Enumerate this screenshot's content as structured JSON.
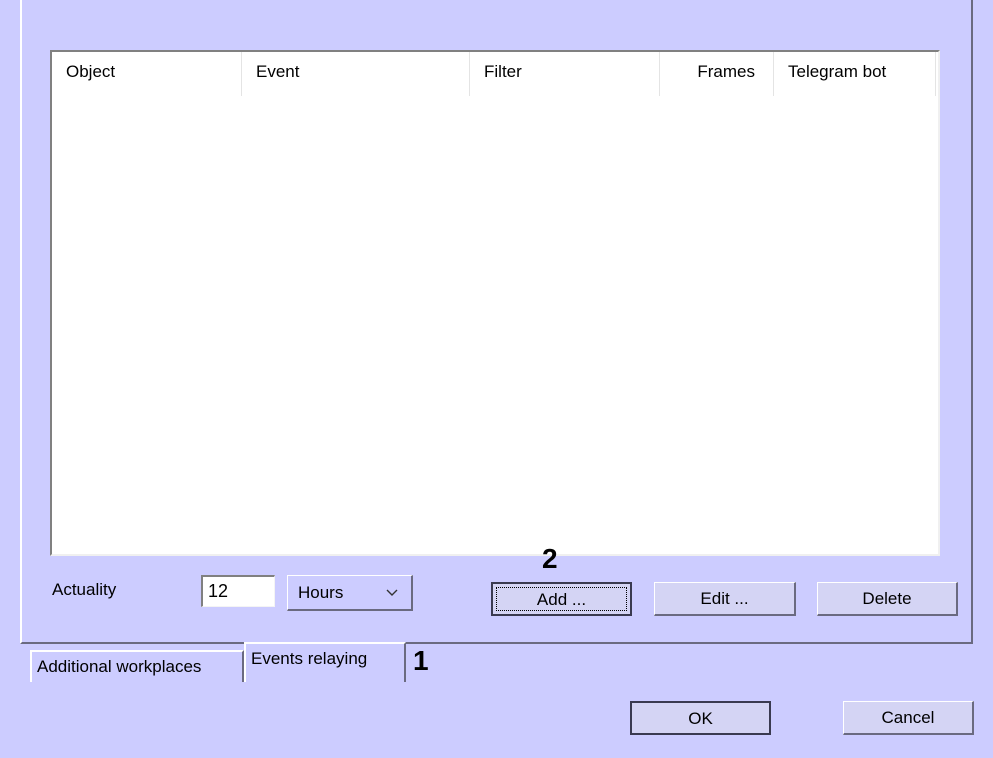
{
  "listview": {
    "columns": [
      "Object",
      "Event",
      "Filter",
      "Frames",
      "Telegram bot"
    ],
    "rows": []
  },
  "actuality": {
    "label": "Actuality",
    "value": "12",
    "unit": "Hours"
  },
  "buttons": {
    "add": "Add ...",
    "edit": "Edit ...",
    "delete": "Delete",
    "ok": "OK",
    "cancel": "Cancel"
  },
  "tabs": [
    "Additional workplaces",
    "Events relaying"
  ],
  "active_tab": "Events relaying",
  "markers": {
    "tab": "1",
    "add": "2"
  },
  "icons": {
    "combo_dropdown": "chevron-down-icon"
  },
  "colors": {
    "dialog_bg": "#ccccff",
    "list_bg": "#ffffff"
  }
}
